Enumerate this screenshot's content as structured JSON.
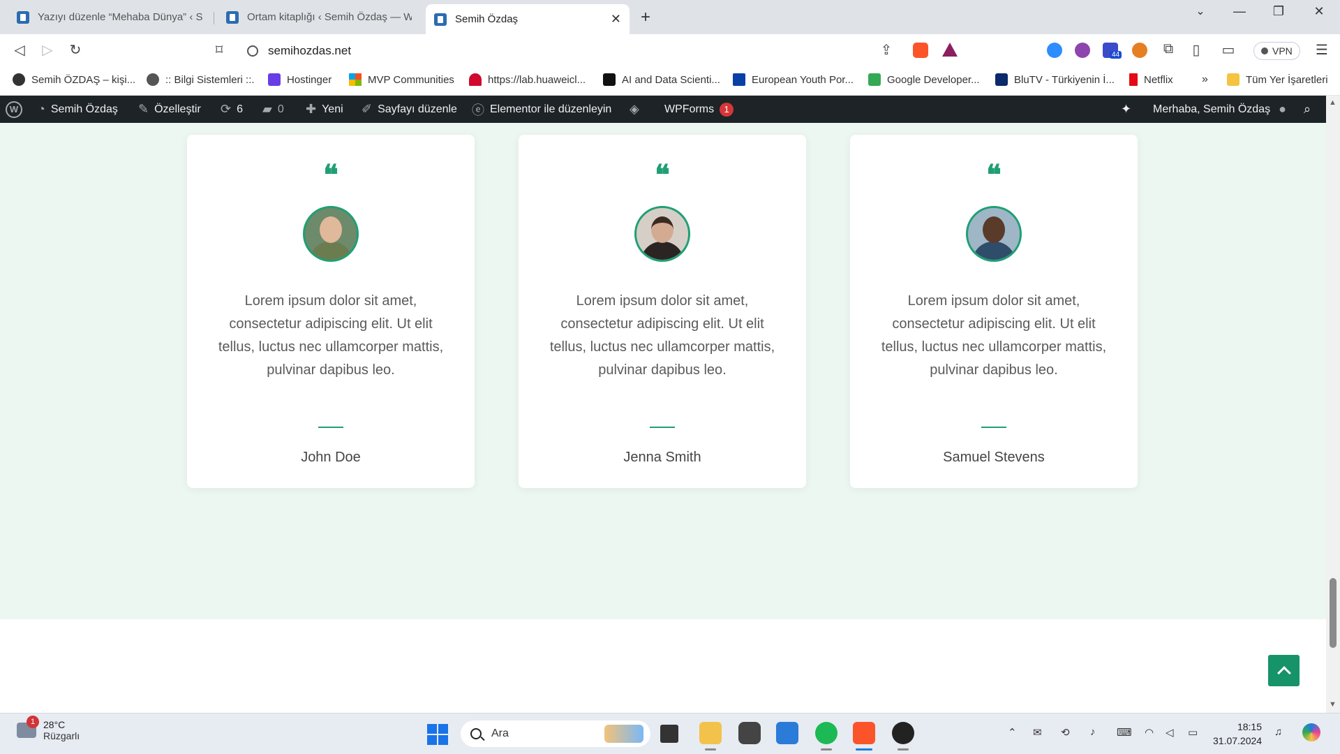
{
  "browser": {
    "tabs": [
      {
        "title": "Yazıyı düzenle “Mehaba Dünya” ‹ Se",
        "active": false
      },
      {
        "title": "Ortam kitaplığı ‹ Semih Özdaş — W",
        "active": false
      },
      {
        "title": "Semih Özdaş",
        "active": true
      }
    ],
    "url": "semihozdas.net",
    "vpn_label": "VPN",
    "extension_badge": "44",
    "bookmarks": [
      "Semih ÖZDAŞ – kişi...",
      ":: Bilgi Sistemleri ::.",
      "Hostinger",
      "MVP Communities",
      "https://lab.huaweicl...",
      "AI and Data Scienti...",
      "European Youth Por...",
      "Google Developer...",
      "BluTV - Türkiyenin İ...",
      "Netflix"
    ],
    "bookmarks_overflow": "»",
    "all_bookmarks": "Tüm Yer İşaretleri"
  },
  "wpbar": {
    "site_name": "Semih Özdaş",
    "customize": "Özelleştir",
    "updates": "6",
    "comments": "0",
    "new": "Yeni",
    "edit_page": "Sayfayı düzenle",
    "elementor": "Elementor ile düzenleyin",
    "wpforms": "WPForms",
    "wpforms_count": "1",
    "greeting": "Merhaba, Semih Özdaş"
  },
  "testimonials": [
    {
      "text": "Lorem ipsum dolor sit amet, consectetur adipiscing elit. Ut elit tellus, luctus nec ullamcorper mattis, pulvinar dapibus leo.",
      "name": "John Doe"
    },
    {
      "text": "Lorem ipsum dolor sit amet, consectetur adipiscing elit. Ut elit tellus, luctus nec ullamcorper mattis, pulvinar dapibus leo.",
      "name": "Jenna Smith"
    },
    {
      "text": "Lorem ipsum dolor sit amet, consectetur adipiscing elit. Ut elit tellus, luctus nec ullamcorper mattis, pulvinar dapibus leo.",
      "name": "Samuel Stevens"
    }
  ],
  "colors": {
    "accent": "#1f9f74",
    "section_bg": "#edf7f1",
    "admin_bar": "#1d2327"
  },
  "taskbar": {
    "weather_badge": "1",
    "temperature": "28°C",
    "condition": "Rüzgarlı",
    "search_placeholder": "Ara",
    "time": "18:15",
    "date": "31.07.2024"
  }
}
